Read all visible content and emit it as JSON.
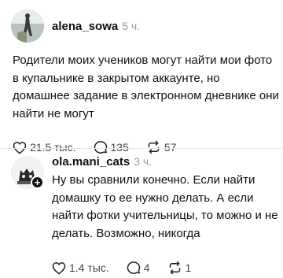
{
  "post": {
    "username": "alena_sowa",
    "time": "5 ч.",
    "text": "Родители моих учеников могут найти мои фото\nв купальнике в закрытом аккаунте, но\nдомашнее задание в электронном дневнике они\nнайти не могут",
    "likes": "21.5 тыс.",
    "replies": "135",
    "reposts": "57"
  },
  "reply": {
    "username": "ola.mani_cats",
    "time": "3 ч.",
    "text": "Ну вы сравнили конечно. Если найти\nдомашку то ее нужно делать. А если\nнайти фотки учительницы, то можно и не\nделать. Возможно, никогда",
    "likes": "1.4 тыс.",
    "replies": "4",
    "reposts": "1",
    "follow_badge": "+"
  },
  "icons": {
    "like": "heart-icon",
    "reply": "comment-icon",
    "repost": "repost-icon",
    "follow": "plus-icon"
  }
}
